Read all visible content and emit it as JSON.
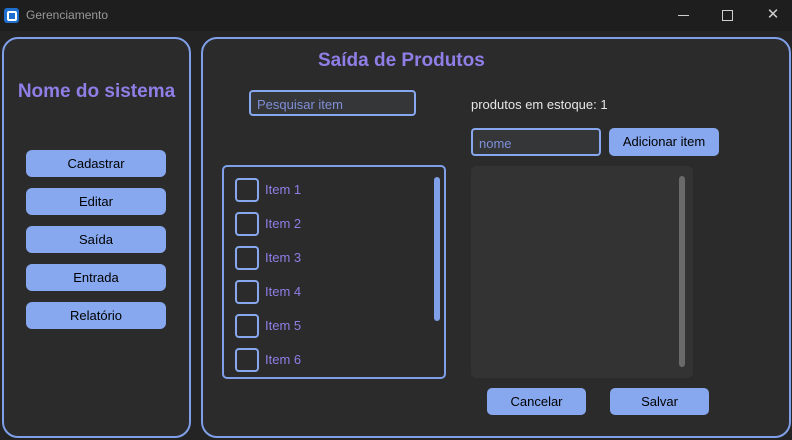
{
  "window": {
    "title": "Gerenciamento",
    "controls": {
      "minimize_icon": "minimize-icon",
      "maximize_icon": "maximize-icon",
      "close_label": "✕"
    }
  },
  "sidebar": {
    "system_name": "Nome do sistema",
    "items": [
      {
        "label": "Cadastrar"
      },
      {
        "label": "Editar"
      },
      {
        "label": "Saída"
      },
      {
        "label": "Entrada"
      },
      {
        "label": "Relatório"
      }
    ]
  },
  "main": {
    "title": "Saída de Produtos",
    "search": {
      "placeholder": "Pesquisar item",
      "value": ""
    },
    "stock_label": "produtos em estoque: 1",
    "name_input": {
      "placeholder": "nome",
      "value": ""
    },
    "add_button": "Adicionar item",
    "items": [
      {
        "label": "Item 1",
        "checked": false
      },
      {
        "label": "Item 2",
        "checked": false
      },
      {
        "label": "Item 3",
        "checked": false
      },
      {
        "label": "Item 4",
        "checked": false
      },
      {
        "label": "Item 5",
        "checked": false
      },
      {
        "label": "Item 6",
        "checked": false
      }
    ],
    "cancel_button": "Cancelar",
    "save_button": "Salvar"
  },
  "colors": {
    "accent": "#87a8ee",
    "heading": "#8f7ee6",
    "background": "#242424",
    "panel": "#2b2b2b"
  }
}
